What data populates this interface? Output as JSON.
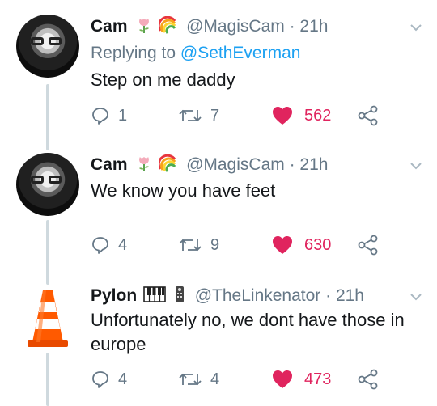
{
  "tweets": [
    {
      "name": "Cam",
      "handle": "@MagisCam · 21h",
      "replying_prefix": "Replying to ",
      "replying_to": "@SethEverman",
      "text": "Step on me daddy",
      "replies": "1",
      "retweets": "7",
      "likes": "562",
      "avatar_icon": "profile-photo",
      "badge_icons": [
        "tulip-emoji",
        "rainbow-emoji"
      ]
    },
    {
      "name": "Cam",
      "handle": "@MagisCam · 21h",
      "text": "We know you have feet",
      "replies": "4",
      "retweets": "9",
      "likes": "630",
      "avatar_icon": "profile-photo",
      "badge_icons": [
        "tulip-emoji",
        "rainbow-emoji"
      ]
    },
    {
      "name": "Pylon",
      "handle": "@TheLinkenator · 21h",
      "text_line1": "Unfortunately no, we dont have those in",
      "text_line2": "europe",
      "replies": "4",
      "retweets": "4",
      "likes": "473",
      "avatar_icon": "traffic-cone",
      "badge_icons": [
        "piano-keys-emoji",
        "remote-emoji"
      ]
    }
  ],
  "colors": {
    "text": "#14171a",
    "muted": "#657786",
    "link": "#1da1f2",
    "like": "#e0245e",
    "thread_line": "#cfd9de"
  }
}
